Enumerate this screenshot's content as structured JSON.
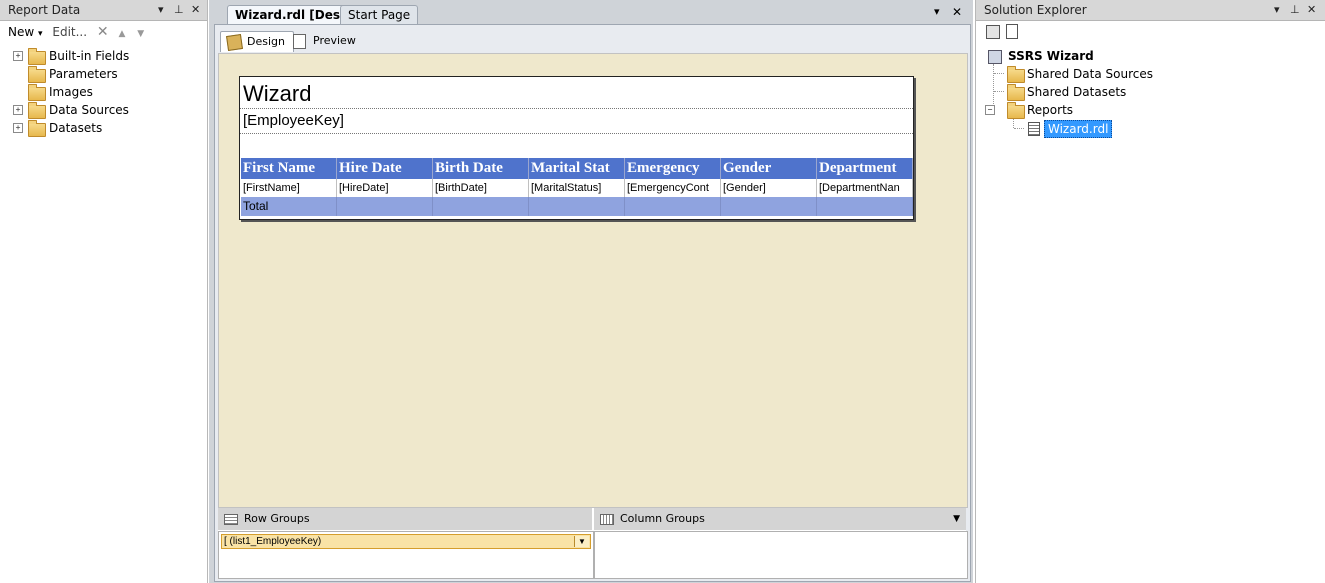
{
  "report_data_panel": {
    "title": "Report Data",
    "toolbar": {
      "new_label": "New",
      "edit_label": "Edit..."
    },
    "items": [
      {
        "label": "Built-in Fields",
        "expandable": true
      },
      {
        "label": "Parameters",
        "expandable": false
      },
      {
        "label": "Images",
        "expandable": false
      },
      {
        "label": "Data Sources",
        "expandable": true
      },
      {
        "label": "Datasets",
        "expandable": true
      }
    ]
  },
  "document": {
    "tabs": [
      {
        "label": "Wizard.rdl [Design]",
        "active": true
      },
      {
        "label": "Start Page",
        "active": false
      }
    ],
    "view_tabs": [
      {
        "label": "Design",
        "active": true
      },
      {
        "label": "Preview",
        "active": false
      }
    ],
    "report": {
      "title": "Wizard",
      "group_field": "[EmployeeKey]",
      "columns": [
        "First Name",
        "Hire Date",
        "Birth Date",
        "Marital Stat",
        "Emergency",
        "Gender",
        "Department"
      ],
      "detail": [
        "[FirstName]",
        "[HireDate]",
        "[BirthDate]",
        "[MaritalStatus]",
        "[EmergencyCont",
        "[Gender]",
        "[DepartmentNan"
      ],
      "total_label": "Total"
    },
    "row_groups": {
      "label": "Row Groups",
      "item": "[ (list1_EmployeeKey)"
    },
    "column_groups": {
      "label": "Column Groups"
    }
  },
  "solution_explorer": {
    "title": "Solution Explorer",
    "project": "SSRS Wizard",
    "folders": [
      "Shared Data Sources",
      "Shared Datasets",
      "Reports"
    ],
    "selected_file": "Wizard.rdl"
  },
  "colors": {
    "header_blue": "#4f73cc",
    "total_blue": "#8fa3df",
    "canvas_beige": "#efe8cc",
    "selection_blue": "#3399ff"
  }
}
